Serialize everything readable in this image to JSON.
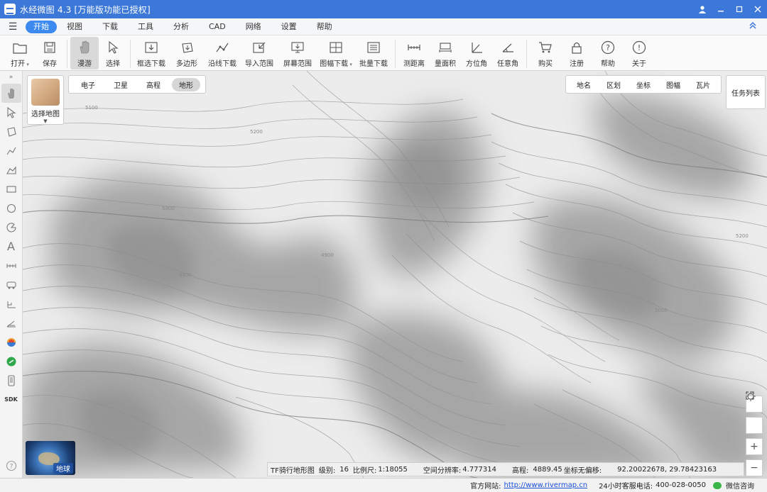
{
  "window": {
    "title": "水经微图 4.3 [万能版功能已授权]",
    "controls": [
      "user-icon",
      "minimize-icon",
      "maximize-icon",
      "close-icon"
    ]
  },
  "menu": {
    "items": [
      "开始",
      "视图",
      "下载",
      "工具",
      "分析",
      "CAD",
      "网络",
      "设置",
      "帮助"
    ],
    "active": "开始"
  },
  "toolbar": {
    "items": [
      {
        "label": "打开",
        "icon": "folder-icon",
        "dropdown": true
      },
      {
        "label": "保存",
        "icon": "save-icon"
      },
      {
        "label": "漫游",
        "icon": "hand-icon",
        "active": true
      },
      {
        "label": "选择",
        "icon": "cursor-icon"
      },
      {
        "label": "框选下载",
        "icon": "box-download-icon"
      },
      {
        "label": "多边形",
        "icon": "polygon-icon"
      },
      {
        "label": "沿线下载",
        "icon": "polyline-icon"
      },
      {
        "label": "导入范围",
        "icon": "import-icon"
      },
      {
        "label": "屏幕范围",
        "icon": "screen-icon"
      },
      {
        "label": "图幅下载",
        "icon": "grid-icon",
        "dropdown": true
      },
      {
        "label": "批量下载",
        "icon": "batch-icon"
      },
      {
        "label": "测距离",
        "icon": "ruler-icon"
      },
      {
        "label": "量面积",
        "icon": "area-icon"
      },
      {
        "label": "方位角",
        "icon": "azimuth-icon"
      },
      {
        "label": "任意角",
        "icon": "angle-icon"
      },
      {
        "label": "购买",
        "icon": "cart-icon"
      },
      {
        "label": "注册",
        "icon": "lock-icon"
      },
      {
        "label": "帮助",
        "icon": "help-icon"
      },
      {
        "label": "关于",
        "icon": "info-icon"
      }
    ]
  },
  "left_tools": [
    "expand-icon",
    "hand-icon",
    "cursor-icon",
    "polygon-icon",
    "polyline-icon",
    "area-icon",
    "rectangle-icon",
    "circle-icon",
    "sector-icon",
    "text-icon",
    "ruler-icon",
    "vehicle-icon",
    "elevation-icon",
    "slope-icon",
    "rainbow-icon",
    "link-icon",
    "phone-icon",
    "sdk-label",
    "help-icon"
  ],
  "sdk_label": "SDK",
  "map": {
    "selector_label": "选择地图",
    "map_types": [
      "电子",
      "卫星",
      "高程",
      "地形"
    ],
    "active_map_type": "地形",
    "overlays": [
      "地名",
      "区划",
      "坐标",
      "图幅",
      "瓦片"
    ],
    "task_list": "任务列表",
    "globe_label": "地球",
    "status": {
      "source": "TF骑行地形图",
      "level_label": "级别:",
      "level": "16",
      "scale_label": "比例尺:",
      "scale": "1:18055",
      "resolution_label": "空间分辨率:",
      "resolution": "4.777314",
      "elevation_label": "高程:",
      "elevation": "4889.45",
      "coord_label": "坐标无偏移:",
      "coords": "92.20022678, 29.78423163"
    },
    "contour_labels": [
      "5100",
      "5200",
      "5000",
      "4900",
      "4800"
    ]
  },
  "statusbar": {
    "site_label": "官方网站:",
    "site_url": "http://www.rivermap.cn",
    "hotline_label": "24小时客服电话:",
    "hotline": "400-028-0050",
    "wechat": "微信咨询"
  }
}
